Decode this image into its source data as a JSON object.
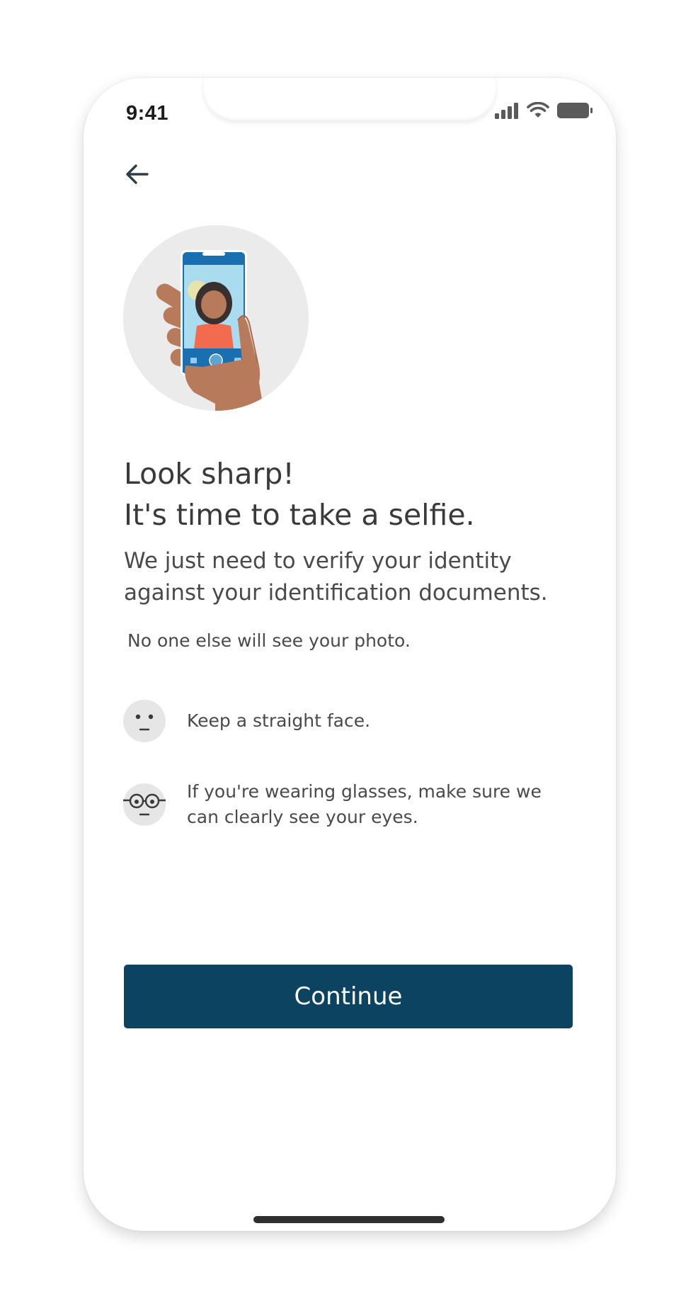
{
  "status_bar": {
    "time": "9:41",
    "icons": [
      "cellular-signal-icon",
      "wifi-icon",
      "battery-icon"
    ]
  },
  "nav": {
    "back_icon": "arrow-left-icon"
  },
  "hero": {
    "illustration": "selfie-hand-phone-illustration"
  },
  "content": {
    "title_line1": "Look sharp!",
    "title_line2": "It's time to take a selfie.",
    "subtitle": "We just need to verify your identity against your identification documents.",
    "privacy_note": "No one else will see your photo.",
    "tips": [
      {
        "icon": "straight-face-icon",
        "text": "Keep a straight face."
      },
      {
        "icon": "glasses-face-icon",
        "text": "If you're wearing glasses, make sure we can clearly see your eyes."
      }
    ]
  },
  "actions": {
    "continue_label": "Continue"
  },
  "colors": {
    "primary_button": "#0b4360",
    "text": "#3a3a3a",
    "icon_circle": "#e6e6e6"
  }
}
